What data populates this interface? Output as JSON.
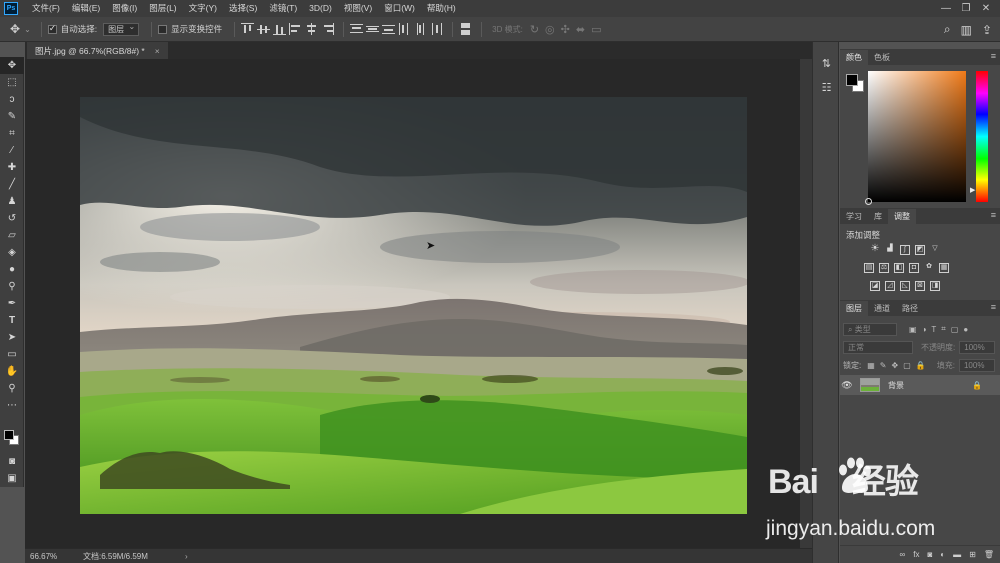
{
  "app": {
    "logo": "Ps",
    "menu": [
      "文件(F)",
      "编辑(E)",
      "图像(I)",
      "图层(L)",
      "文字(Y)",
      "选择(S)",
      "滤镜(T)",
      "3D(D)",
      "视图(V)",
      "窗口(W)",
      "帮助(H)"
    ],
    "window_controls": [
      "—",
      "❐",
      "✕"
    ]
  },
  "options": {
    "auto_select_label": "自动选择:",
    "auto_select_checked": true,
    "auto_select_target": "图层",
    "show_transform_label": "显示变换控件",
    "show_transform_checked": false,
    "mode_3d_label": "3D 模式:"
  },
  "document": {
    "tab_title": "图片.jpg @ 66.7%(RGB/8#) *",
    "tab_close": "×",
    "zoom": "66.67%",
    "doc_size": "文档:6.59M/6.59M",
    "status_arrow": "›"
  },
  "panels": {
    "color_tabs": [
      "颜色",
      "色板"
    ],
    "adjust_tabs": [
      "学习",
      "库",
      "调整"
    ],
    "adjust_title": "添加调整",
    "layer_tabs": [
      "图层",
      "通道",
      "路径"
    ],
    "layer_filter": "类型",
    "blend_mode": "正常",
    "opacity_label": "不透明度:",
    "opacity_value": "100%",
    "lock_label": "锁定:",
    "fill_label": "填充:",
    "fill_value": "100%",
    "layers": [
      {
        "name": "背景",
        "visible": true,
        "locked": true
      }
    ],
    "footer_icons": [
      "link-icon",
      "fx-icon",
      "mask-icon",
      "adjustment-icon",
      "group-icon",
      "new-layer-icon",
      "trash-icon"
    ]
  },
  "watermark": {
    "brand": "Bai",
    "brand_cn": "经验",
    "site": "jingyan.baidu.com"
  },
  "colors": {
    "ps_blue": "#31a8ff",
    "chrome_dark": "#282828",
    "panel_bg": "#474747"
  }
}
